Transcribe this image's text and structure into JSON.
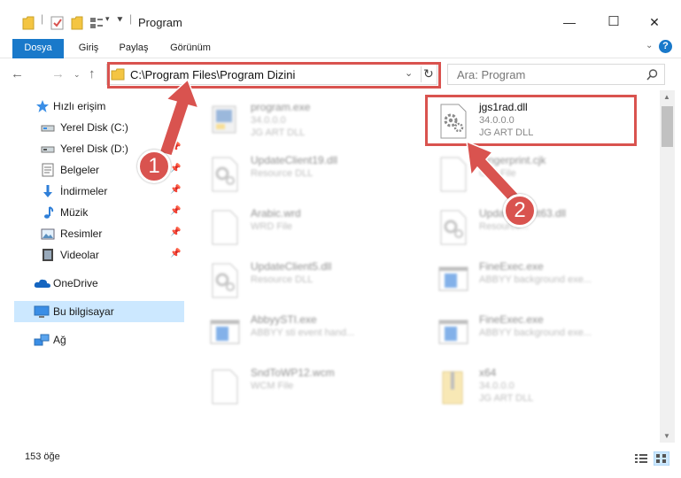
{
  "window": {
    "title": "Program",
    "minimize": "—",
    "maximize": "☐",
    "close": "✕"
  },
  "ribbon": {
    "tabs": [
      {
        "label": "Dosya",
        "active": true
      },
      {
        "label": "Giriş"
      },
      {
        "label": "Paylaş"
      },
      {
        "label": "Görünüm"
      }
    ],
    "help": "?"
  },
  "address": {
    "path": "C:\\Program Files\\Program Dizini",
    "search_placeholder": "Ara: Program"
  },
  "sidebar": {
    "items": [
      {
        "label": "Hızlı erişim",
        "icon": "star-icon"
      },
      {
        "label": "Yerel Disk (C:)",
        "icon": "drive-icon",
        "pinned": true
      },
      {
        "label": "Yerel Disk (D:)",
        "icon": "drive-icon",
        "pinned": true
      },
      {
        "label": "Belgeler",
        "icon": "documents-icon",
        "pinned": true
      },
      {
        "label": "İndirmeler",
        "icon": "download-icon",
        "pinned": true
      },
      {
        "label": "Müzik",
        "icon": "music-icon",
        "pinned": true
      },
      {
        "label": "Resimler",
        "icon": "pictures-icon",
        "pinned": true
      },
      {
        "label": "Videolar",
        "icon": "videos-icon",
        "pinned": true
      },
      {
        "label": "OneDrive",
        "icon": "cloud-icon"
      },
      {
        "label": "Bu bilgisayar",
        "icon": "computer-icon",
        "selected": true
      },
      {
        "label": "Ağ",
        "icon": "network-icon"
      }
    ]
  },
  "files": [
    {
      "name": "program.exe",
      "sub1": "34.0.0.0",
      "sub2": "JG ART DLL",
      "icon": "exe-icon"
    },
    {
      "name": "jgs1rad.dll",
      "sub1": "34.0.0.0",
      "sub2": "JG ART DLL",
      "icon": "dll-gear-icon",
      "highlighted": true
    },
    {
      "name": "UpdateClient19.dll",
      "sub1": "Resource DLL",
      "sub2": "",
      "icon": "dll-gear-icon"
    },
    {
      "name": "Fingerprint.cjk",
      "sub1": "CJK File",
      "sub2": "",
      "icon": "blank-file-icon"
    },
    {
      "name": "Arabic.wrd",
      "sub1": "WRD File",
      "sub2": "",
      "icon": "blank-file-icon"
    },
    {
      "name": "UpdateClient63.dll",
      "sub1": "Resource...",
      "sub2": "",
      "icon": "dll-gear-icon"
    },
    {
      "name": "UpdateClient5.dll",
      "sub1": "Resource DLL",
      "sub2": "",
      "icon": "dll-gear-icon"
    },
    {
      "name": "FineExec.exe",
      "sub1": "ABBYY background exe...",
      "sub2": "",
      "icon": "app-window-icon"
    },
    {
      "name": "AbbyySTI.exe",
      "sub1": "ABBYY sti event hand...",
      "sub2": "",
      "icon": "app-window-icon"
    },
    {
      "name": "FineExec.exe",
      "sub1": "ABBYY background exe...",
      "sub2": "",
      "icon": "app-window-icon"
    },
    {
      "name": "SndToWP12.wcm",
      "sub1": "WCM File",
      "sub2": "",
      "icon": "blank-file-icon"
    },
    {
      "name": "x64",
      "sub1": "34.0.0.0",
      "sub2": "JG ART DLL",
      "icon": "zip-folder-icon"
    }
  ],
  "status": {
    "count": "153 öğe"
  },
  "annotations": {
    "badge1": "1",
    "badge2": "2"
  },
  "colors": {
    "accent": "#1979ca",
    "annotation_red": "#d9534f",
    "selected_bg": "#cce8ff"
  }
}
